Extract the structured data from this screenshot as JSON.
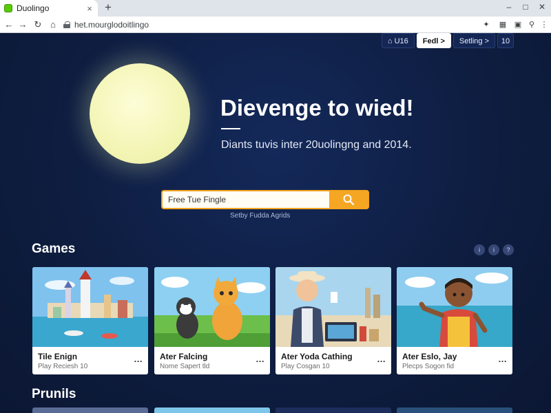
{
  "browser": {
    "tab_title": "Duolingo",
    "tab_close": "×",
    "new_tab": "+",
    "url": "het.mourglodoitlingo",
    "window_controls": [
      "–",
      "□",
      "✕"
    ]
  },
  "nav": {
    "items": [
      {
        "label": "⌂ U16",
        "active": false
      },
      {
        "label": "Fedl >",
        "active": true
      },
      {
        "label": "Setling >",
        "active": false
      }
    ],
    "number": "10"
  },
  "hero": {
    "title": "Dievenge to wied!",
    "subtitle": "Diants tuvis inter 20uolingng and 2014."
  },
  "search": {
    "value": "Free Tue Fingle",
    "caption": "Setby Fudda Agrids"
  },
  "sections": {
    "games": "Games",
    "second": "Prunils"
  },
  "carousel": {
    "controls": [
      "i",
      "i",
      "?"
    ]
  },
  "cards": [
    {
      "title": "Tile Enign",
      "subtitle": "Play Reciesh 10",
      "more": "..."
    },
    {
      "title": "Ater Falcing",
      "subtitle": "Nome Sapert tld",
      "more": "..."
    },
    {
      "title": "Ater Yoda Cathing",
      "subtitle": "Play Cosgan 10",
      "more": "..."
    },
    {
      "title": "Ater Eslo, Jay",
      "subtitle": "Plecps Sogon fid",
      "more": "..."
    }
  ],
  "colors": {
    "page_bg": "#0f1f44",
    "accent": "#f5a623",
    "moon": "#f3f5b5"
  }
}
